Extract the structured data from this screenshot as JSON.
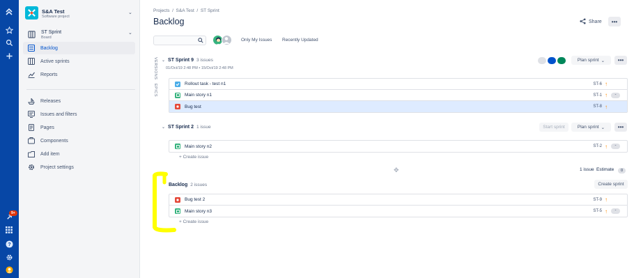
{
  "sidebar": {
    "project_name": "S&A Test",
    "project_type": "Software project",
    "board_name": "ST Sprint",
    "board_type": "Board",
    "items": [
      {
        "label": "Backlog",
        "icon": "backlog-icon"
      },
      {
        "label": "Active sprints",
        "icon": "board-icon"
      },
      {
        "label": "Reports",
        "icon": "reports-icon"
      },
      {
        "label": "Releases",
        "icon": "ship-icon"
      },
      {
        "label": "Issues and filters",
        "icon": "issues-icon"
      },
      {
        "label": "Pages",
        "icon": "page-icon"
      },
      {
        "label": "Components",
        "icon": "component-icon"
      },
      {
        "label": "Add item",
        "icon": "add-item-icon"
      },
      {
        "label": "Project settings",
        "icon": "settings-icon"
      }
    ]
  },
  "global_nav": {
    "notification_count": "9+"
  },
  "header": {
    "breadcrumb": [
      "Projects",
      "S&A Test",
      "ST Sprint"
    ],
    "title": "Backlog",
    "share_label": "Share"
  },
  "filters": {
    "only_my_issues": "Only My Issues",
    "recently_updated": "Recently Updated"
  },
  "side_tabs": {
    "versions": "VERSIONS",
    "epics": "EPICS"
  },
  "sprints": [
    {
      "name": "ST Sprint 9",
      "count": "3 issues",
      "dates": "01/Oct/19 2:48 PM • 15/Oct/19 2:48 PM",
      "status_colors": [
        "#DFE1E6",
        "#0052CC",
        "#00875A"
      ],
      "action": "Plan sprint",
      "issues": [
        {
          "type": "task",
          "summary": "Rollout task - test n1",
          "key": "ST-6",
          "estimate": ""
        },
        {
          "type": "story",
          "summary": "Main story n1",
          "key": "ST-1",
          "estimate": "-"
        },
        {
          "type": "bug",
          "summary": "Bug test",
          "key": "ST-8",
          "estimate": ""
        }
      ]
    },
    {
      "name": "ST Sprint 2",
      "count": "1 issue",
      "start_label": "Start sprint",
      "action": "Plan sprint",
      "issues": [
        {
          "type": "story",
          "summary": "Main story n2",
          "key": "ST-2",
          "estimate": "-"
        }
      ],
      "create_label": "+ Create issue"
    }
  ],
  "sprint2_footer": {
    "issue_count": "1 issue",
    "estimate_label": "Estimate",
    "estimate_value": "0"
  },
  "backlog": {
    "name": "Backlog",
    "count": "2 issues",
    "action": "Create sprint",
    "issues": [
      {
        "type": "bug",
        "summary": "Bug test 2",
        "key": "ST-9",
        "estimate": ""
      },
      {
        "type": "story",
        "summary": "Main story n3",
        "key": "ST-5",
        "estimate": "-"
      }
    ],
    "create_label": "+ Create issue"
  },
  "colors": {
    "nav": "#0747A6",
    "story": "#36B37E",
    "bug": "#E5493A",
    "task": "#4BADE8",
    "highlight": "#FFFF00"
  }
}
